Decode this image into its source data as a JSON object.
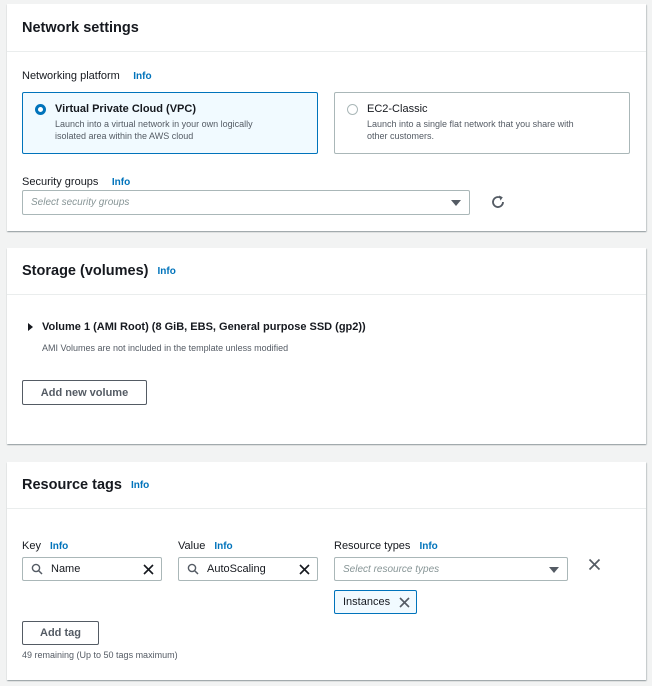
{
  "network": {
    "title": "Network settings",
    "platform_label": "Networking platform",
    "info": "Info",
    "options": [
      {
        "title": "Virtual Private Cloud (VPC)",
        "desc1": "Launch into a virtual network in your own logically",
        "desc2": "isolated area within the AWS cloud",
        "selected": true
      },
      {
        "title": "EC2-Classic",
        "desc1": "Launch into a single flat network that you share with",
        "desc2": "other customers.",
        "selected": false
      }
    ],
    "sg_label": "Security groups",
    "sg_placeholder": "Select security groups"
  },
  "storage": {
    "title": "Storage (volumes)",
    "info": "Info",
    "volume_title": "Volume 1 (AMI Root) (8 GiB, EBS, General purpose SSD (gp2))",
    "volume_note": "AMI Volumes are not included in the template unless modified",
    "add_button": "Add new volume"
  },
  "tags": {
    "title": "Resource tags",
    "info": "Info",
    "key_label": "Key",
    "value_label": "Value",
    "types_label": "Resource types",
    "key_value": "Name",
    "value_value": "AutoScaling",
    "types_placeholder": "Select resource types",
    "token": "Instances",
    "add_button": "Add tag",
    "remaining": "49 remaining (Up to 50 tags maximum)"
  },
  "colors": {
    "accent": "#0073bb",
    "text": "#16191f",
    "muted": "#545b64",
    "border": "#aab7b8"
  }
}
